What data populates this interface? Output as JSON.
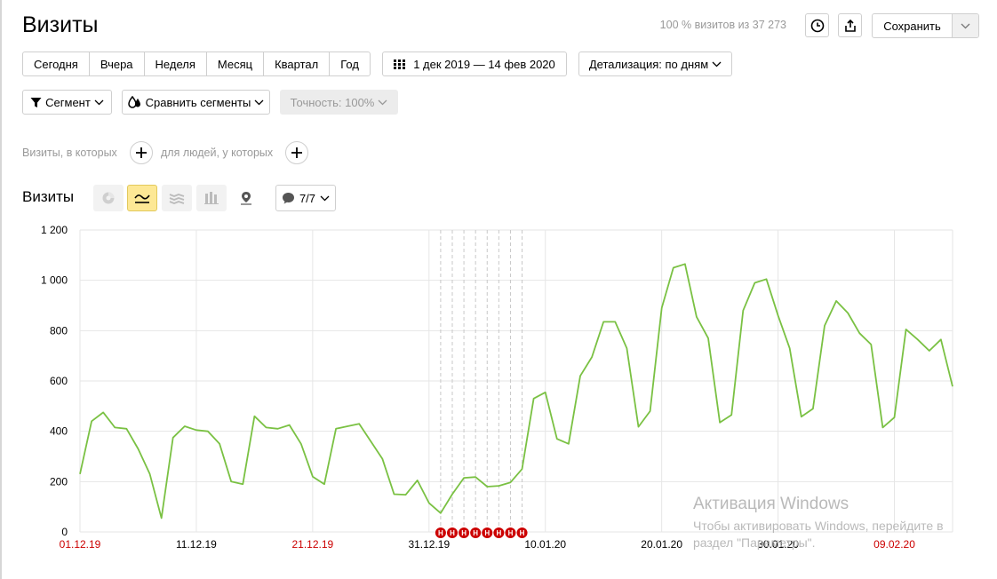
{
  "page": {
    "title": "Визиты",
    "visits_info": "100 % визитов из 37 273"
  },
  "toolbar": {
    "save_label": "Сохранить"
  },
  "period": {
    "items": [
      "Сегодня",
      "Вчера",
      "Неделя",
      "Месяц",
      "Квартал",
      "Год"
    ]
  },
  "date_range": {
    "label": "1 дек 2019 — 14 фев 2020"
  },
  "detail": {
    "label": "Детализация: по дням"
  },
  "segment": {
    "label": "Сегмент"
  },
  "compare": {
    "label": "Сравнить сегменты"
  },
  "precision": {
    "label": "Точность: 100%"
  },
  "conditions": {
    "visits_label": "Визиты, в которых",
    "people_label": "для людей, у которых"
  },
  "chart_section": {
    "title": "Визиты",
    "notes_label": "7/7"
  },
  "icons": {
    "history": "clock-icon",
    "export": "share-icon",
    "dropdown": "chevron-down-icon",
    "calendar": "calendar-grid-icon",
    "segment": "filter-icon",
    "compare": "drops-icon",
    "add": "plus-icon",
    "pie": "pie-chart-icon",
    "line": "line-chart-icon",
    "area": "area-chart-icon",
    "bar": "bar-chart-icon",
    "map": "map-pin-icon",
    "notes": "speech-bubble-icon",
    "holiday": "holiday-marker"
  },
  "watermark": {
    "title": "Активация Windows",
    "text": "Чтобы активировать Windows, перейдите в раздел \"Параметры\"."
  },
  "colors": {
    "line": "#7ac143",
    "grid": "#e6e6e6",
    "weekend": "#cc0000",
    "holiday_marker": "#cc0000",
    "active_viz": "#fde895",
    "muted_text": "#999999"
  },
  "chart_data": {
    "type": "line",
    "title": "",
    "xlabel": "",
    "ylabel": "",
    "ylim": [
      0,
      1200
    ],
    "yticks": [
      0,
      200,
      400,
      600,
      800,
      1000,
      1200
    ],
    "ytick_labels": [
      "0",
      "200",
      "400",
      "600",
      "800",
      "1 000",
      "1 200"
    ],
    "xticks": [
      {
        "label": "01.12.19",
        "date": "2019-12-01",
        "weekend": true
      },
      {
        "label": "11.12.19",
        "date": "2019-12-11",
        "weekend": false
      },
      {
        "label": "21.12.19",
        "date": "2019-12-21",
        "weekend": true
      },
      {
        "label": "31.12.19",
        "date": "2019-12-31",
        "weekend": false
      },
      {
        "label": "10.01.20",
        "date": "2020-01-10",
        "weekend": false
      },
      {
        "label": "20.01.20",
        "date": "2020-01-20",
        "weekend": false
      },
      {
        "label": "30.01.20",
        "date": "2020-01-30",
        "weekend": false
      },
      {
        "label": "09.02.20",
        "date": "2020-02-09",
        "weekend": true
      }
    ],
    "grid": true,
    "holidays": [
      "2020-01-01",
      "2020-01-02",
      "2020-01-03",
      "2020-01-04",
      "2020-01-05",
      "2020-01-06",
      "2020-01-07",
      "2020-01-08"
    ],
    "holiday_label": "Н",
    "series": [
      {
        "x_start": "2019-12-01",
        "x_end": "2020-02-14",
        "values": [
          230,
          440,
          475,
          415,
          410,
          330,
          230,
          55,
          375,
          420,
          405,
          400,
          350,
          200,
          190,
          460,
          415,
          410,
          425,
          350,
          220,
          190,
          410,
          420,
          430,
          360,
          290,
          150,
          148,
          205,
          115,
          75,
          150,
          215,
          218,
          180,
          183,
          197,
          250,
          530,
          555,
          370,
          350,
          620,
          695,
          835,
          835,
          730,
          418,
          480,
          890,
          1050,
          1065,
          855,
          770,
          435,
          465,
          880,
          990,
          1005,
          860,
          730,
          458,
          490,
          820,
          918,
          870,
          790,
          745,
          415,
          455,
          805,
          765,
          720,
          765,
          578
        ]
      }
    ]
  }
}
